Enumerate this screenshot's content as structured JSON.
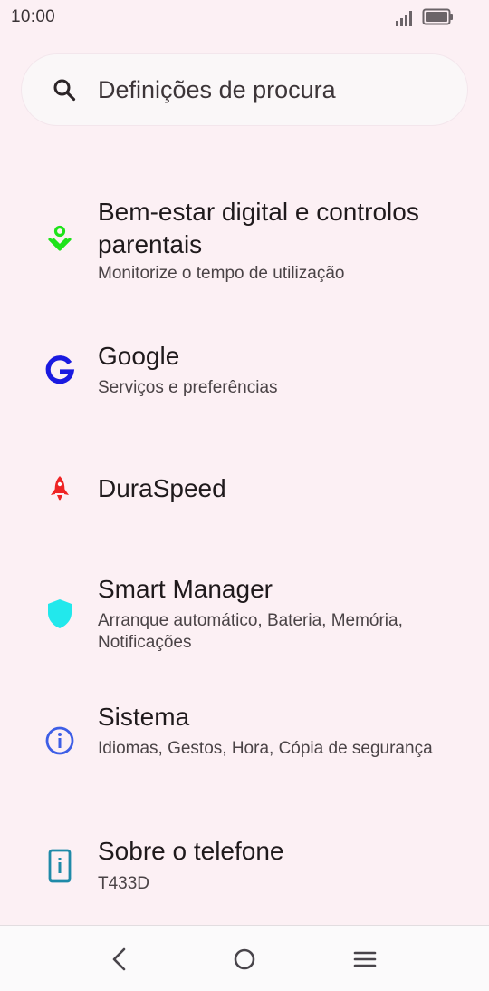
{
  "status_bar": {
    "time": "10:00"
  },
  "search": {
    "placeholder": "Definições de procura",
    "icon": "search-icon"
  },
  "settings": {
    "items": [
      {
        "title": "Bem-estar digital e controlos parentais",
        "subtitle": "Monitorize o tempo de utilização",
        "icon": "digital-wellbeing-icon",
        "icon_color": "#1ee31a"
      },
      {
        "title": "Google",
        "subtitle": "Serviços e preferências",
        "icon": "google-icon",
        "icon_color": "#1a1ae0"
      },
      {
        "title": "DuraSpeed",
        "subtitle": "",
        "icon": "rocket-icon",
        "icon_color": "#ef2525"
      },
      {
        "title": "Smart Manager",
        "subtitle": "Arranque automático, Bateria, Memória, Notificações",
        "icon": "shield-icon",
        "icon_color": "#22e8ec"
      },
      {
        "title": "Sistema",
        "subtitle": "Idiomas, Gestos, Hora, Cópia de segurança",
        "icon": "info-icon",
        "icon_color": "#3d5ee6"
      },
      {
        "title": "Sobre o telefone",
        "subtitle": "T433D",
        "icon": "phone-info-icon",
        "icon_color": "#1f8aa8"
      }
    ]
  },
  "nav_bar": {
    "back": "back-icon",
    "home": "home-icon",
    "menu": "menu-icon"
  }
}
